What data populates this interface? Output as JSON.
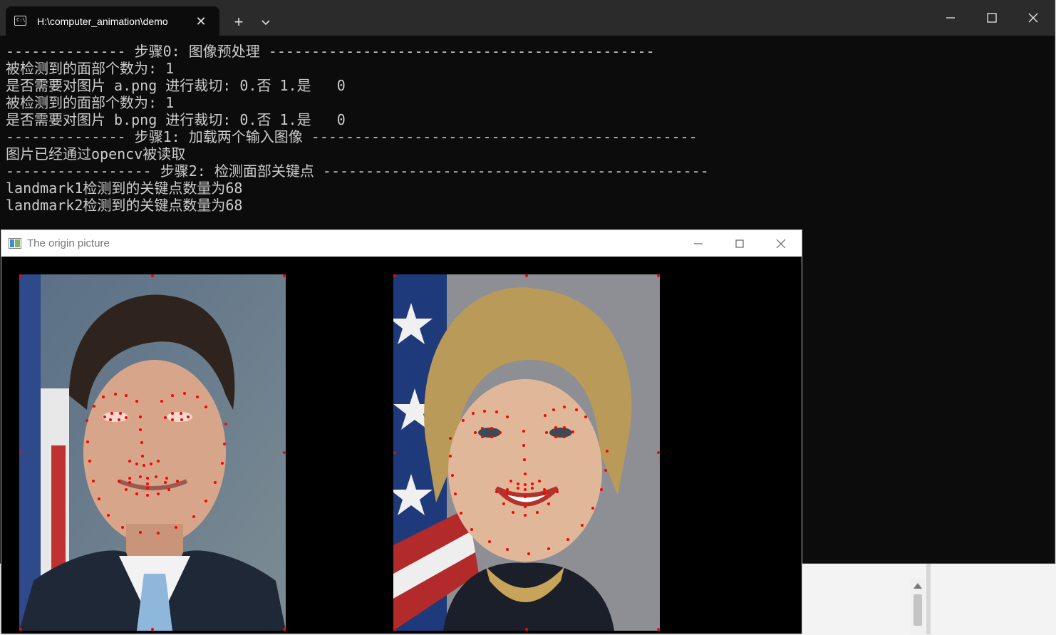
{
  "terminal": {
    "tab_title": "H:\\computer_animation\\demo",
    "tab_icon": "terminal-icon",
    "colors": {
      "background": "#0c0c0c",
      "text": "#cccccc",
      "titlebar": "#2b2b2b"
    },
    "lines": [
      "-------------- 步骤0: 图像预处理 ---------------------------------------------",
      "被检测到的面部个数为: 1",
      "是否需要对图片 a.png 进行裁切: 0.否 1.是   0",
      "被检测到的面部个数为: 1",
      "是否需要对图片 b.png 进行裁切: 0.否 1.是   0",
      "-------------- 步骤1: 加载两个输入图像 ---------------------------------------------",
      "图片已经通过opencv被读取",
      "----------------- 步骤2: 检测面部关键点 ---------------------------------------------",
      "landmark1检测到的关键点数量为68",
      "landmark2检测到的关键点数量为68"
    ]
  },
  "image_window": {
    "title": "The origin picture",
    "images": [
      {
        "name": "a.png",
        "landmark_count": 68,
        "landmark_color": "#ff0000"
      },
      {
        "name": "b.png",
        "landmark_count": 68,
        "landmark_color": "#ff0000"
      }
    ]
  }
}
